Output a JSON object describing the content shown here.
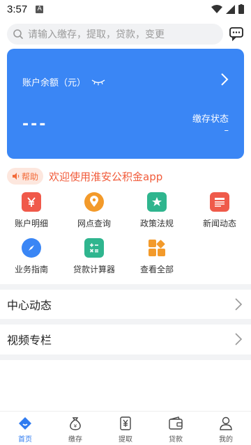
{
  "status_bar": {
    "time": "3:57",
    "notif_letter": "A"
  },
  "search": {
    "placeholder": "请输入缴存，提取，贷款，变更"
  },
  "account_card": {
    "balance_label": "账户余额（元）",
    "balance_value": "---",
    "status_label": "缴存状态",
    "status_value": "–"
  },
  "notice": {
    "help_label": "帮助",
    "text": "欢迎使用淮安公积金app"
  },
  "grid": [
    {
      "label": "账户明细",
      "icon": "yen-card-icon",
      "color": "#f0594a"
    },
    {
      "label": "网点查询",
      "icon": "location-pin-icon",
      "color": "#f39a2a"
    },
    {
      "label": "政策法规",
      "icon": "star-document-icon",
      "color": "#2fb58e"
    },
    {
      "label": "新闻动态",
      "icon": "news-icon",
      "color": "#ef5a4a"
    },
    {
      "label": "业务指南",
      "icon": "compass-icon",
      "color": "#3a86f5"
    },
    {
      "label": "贷款计算器",
      "icon": "calculator-icon",
      "color": "#2fb58e"
    },
    {
      "label": "查看全部",
      "icon": "all-apps-icon",
      "color": "#f39a2a"
    }
  ],
  "sections": [
    {
      "label": "中心动态"
    },
    {
      "label": "视频专栏"
    }
  ],
  "tabs": [
    {
      "label": "首页",
      "icon": "home-icon",
      "active": true
    },
    {
      "label": "缴存",
      "icon": "money-bag-icon",
      "active": false
    },
    {
      "label": "提取",
      "icon": "yen-doc-icon",
      "active": false
    },
    {
      "label": "贷款",
      "icon": "wallet-icon",
      "active": false
    },
    {
      "label": "我的",
      "icon": "user-icon",
      "active": false
    }
  ],
  "colors": {
    "primary": "#3a86f5",
    "notice": "#f15b3a",
    "tab_active": "#2f7bf0"
  }
}
